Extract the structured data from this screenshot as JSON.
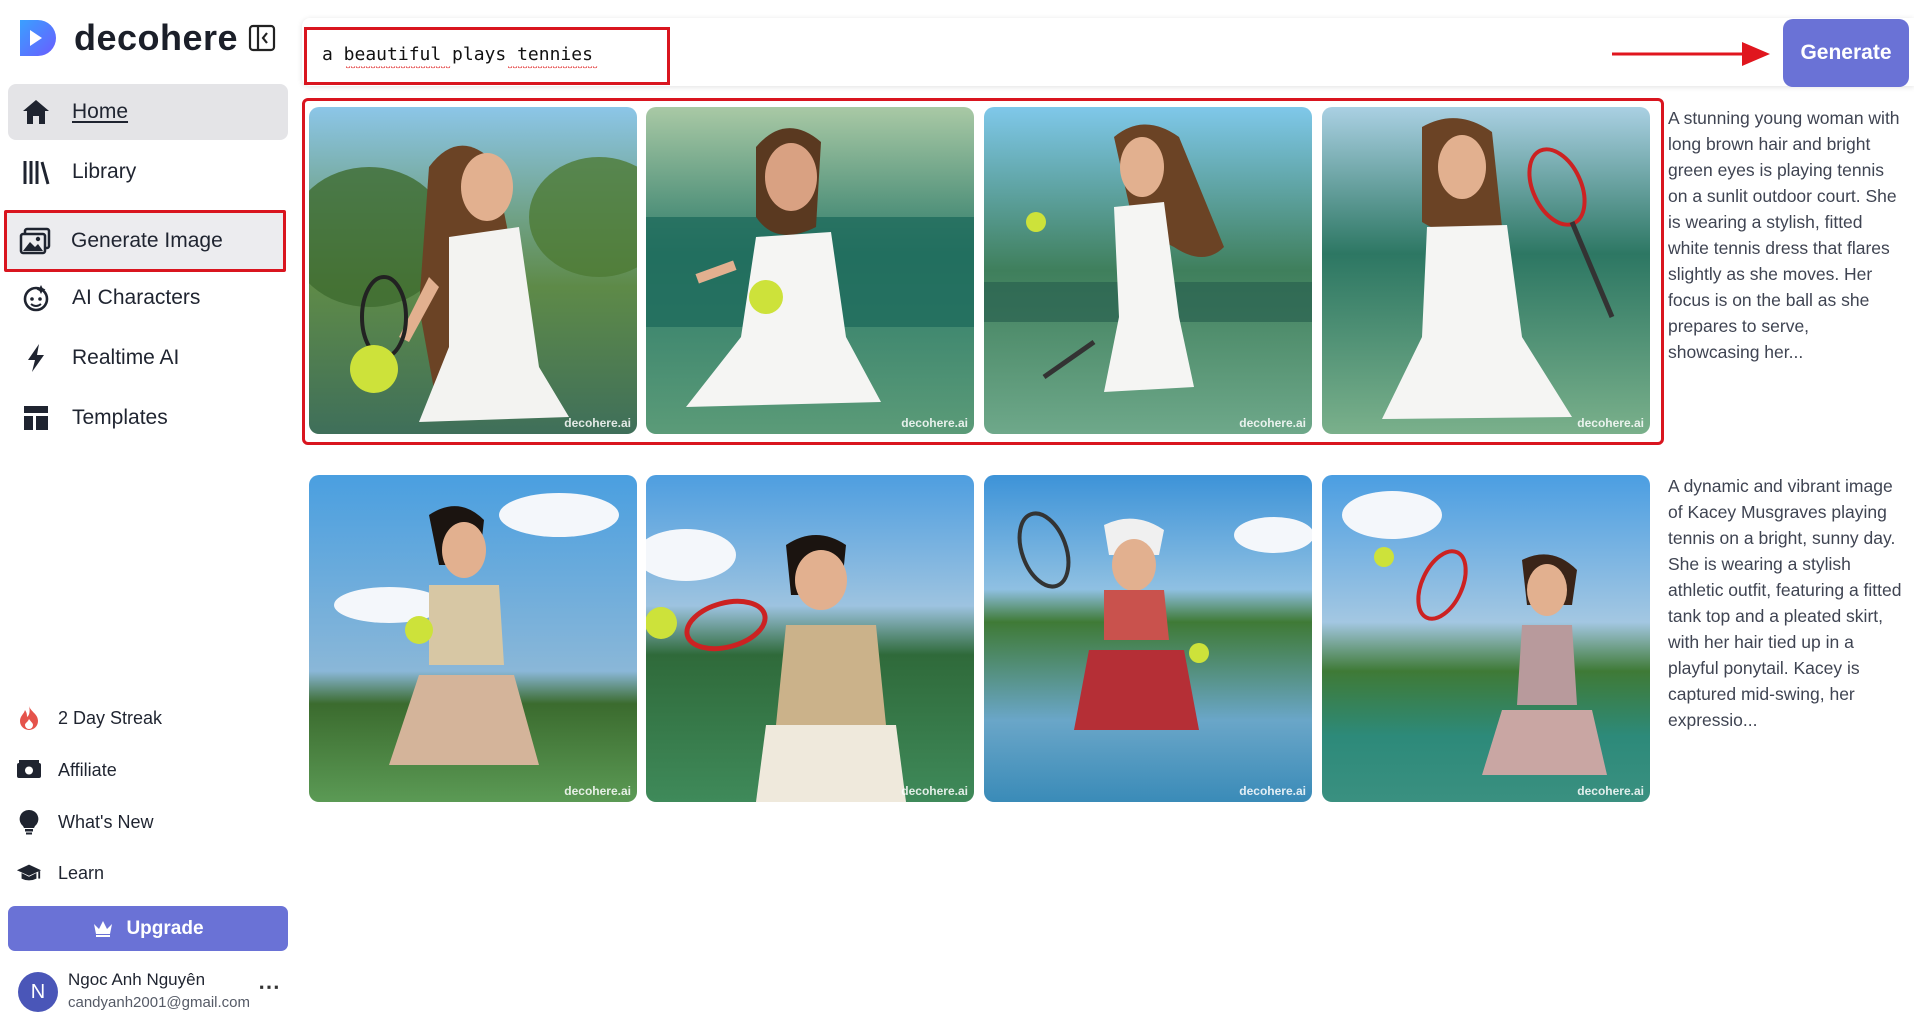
{
  "app": {
    "name": "decohere"
  },
  "sidebar": {
    "items": [
      {
        "label": "Home",
        "icon": "home-icon"
      },
      {
        "label": "Library",
        "icon": "library-icon"
      },
      {
        "label": "Generate Image",
        "icon": "image-icon"
      },
      {
        "label": "AI Characters",
        "icon": "character-icon"
      },
      {
        "label": "Realtime AI",
        "icon": "lightning-icon"
      },
      {
        "label": "Templates",
        "icon": "templates-icon"
      }
    ],
    "secondary": [
      {
        "label": "2 Day Streak",
        "icon": "fire-icon"
      },
      {
        "label": "Affiliate",
        "icon": "money-icon"
      },
      {
        "label": "What's New",
        "icon": "bulb-icon"
      },
      {
        "label": "Learn",
        "icon": "graduation-cap-icon"
      }
    ],
    "upgrade_label": "Upgrade",
    "user": {
      "initial": "N",
      "name": "Ngoc Anh Nguyên",
      "email": "candyanh2001@gmail.com"
    }
  },
  "prompt": {
    "value": "a beautiful plays tennies"
  },
  "generate_label": "Generate",
  "results": [
    {
      "description": "A stunning young woman with long brown hair and bright green eyes is playing tennis on a sunlit outdoor court. She is wearing a stylish, fitted white tennis dress that flares slightly as she moves. Her focus is on the ball as she prepares to serve, showcasing her...",
      "watermarks": [
        "decohere.ai",
        "decohere.ai",
        "decohere.ai",
        "decohere.ai"
      ]
    },
    {
      "description": "A dynamic and vibrant image of Kacey Musgraves playing tennis on a bright, sunny day. She is wearing a stylish athletic outfit, featuring a fitted tank top and a pleated skirt, with her hair tied up in a playful ponytail. Kacey is captured mid-swing, her expressio...",
      "watermarks": [
        "decohere.ai",
        "decohere.ai",
        "decohere.ai",
        "decohere.ai"
      ]
    }
  ],
  "colors": {
    "accent": "#6a72d6",
    "highlight": "#d9151f",
    "nav_active": "#e4e4e7"
  }
}
